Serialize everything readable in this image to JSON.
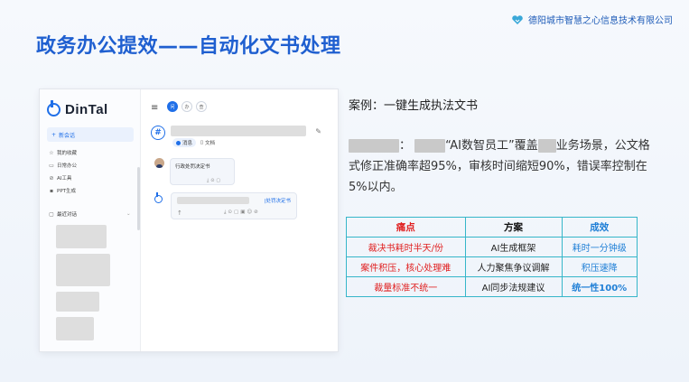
{
  "company": {
    "name": "德阳城市智慧之心信息技术有限公司",
    "icon": "heart-logo-icon"
  },
  "slide": {
    "title": "政务办公提效——自动化文书处理"
  },
  "app": {
    "brand": "DinTal",
    "new_chat": "新会话",
    "sidebar_items": [
      {
        "label": "我的收藏",
        "icon": "star-icon"
      },
      {
        "label": "日常办公",
        "icon": "briefcase-icon"
      },
      {
        "label": "AI工具",
        "icon": "ai-tool-icon"
      },
      {
        "label": "PPT生成",
        "icon": "ppt-icon"
      }
    ],
    "recent_label": "最近对话",
    "tabs": [
      "问",
      "办",
      "查"
    ],
    "filter_pills": [
      {
        "label": "消息",
        "active": true
      },
      {
        "label": "文档",
        "active": false
      }
    ],
    "user_message": "行政处罚决定书",
    "bot_title": "|处罚决定书"
  },
  "case": {
    "heading": "案例：一键生成执法文书",
    "desc_part1": "：",
    "desc_part2": "“AI数智员工”覆盖",
    "desc_part3": "业务场景，公文格式修正准确率超95%，审核时间缩短90%，错误率控制在5%以内。"
  },
  "table": {
    "headers": [
      "痛点",
      "方案",
      "成效"
    ],
    "rows": [
      [
        "裁决书耗时半天/份",
        "AI生成框架",
        "耗时一分钟级"
      ],
      [
        "案件积压，核心处理难",
        "人力聚焦争议调解",
        "积压速降"
      ],
      [
        "裁量标准不统一",
        "AI同步法规建议",
        "统一性100%"
      ]
    ]
  },
  "colors": {
    "title": "#1f5fd0",
    "pain": "#e02020",
    "effect": "#1f7fd6",
    "border": "#36b6c9"
  }
}
